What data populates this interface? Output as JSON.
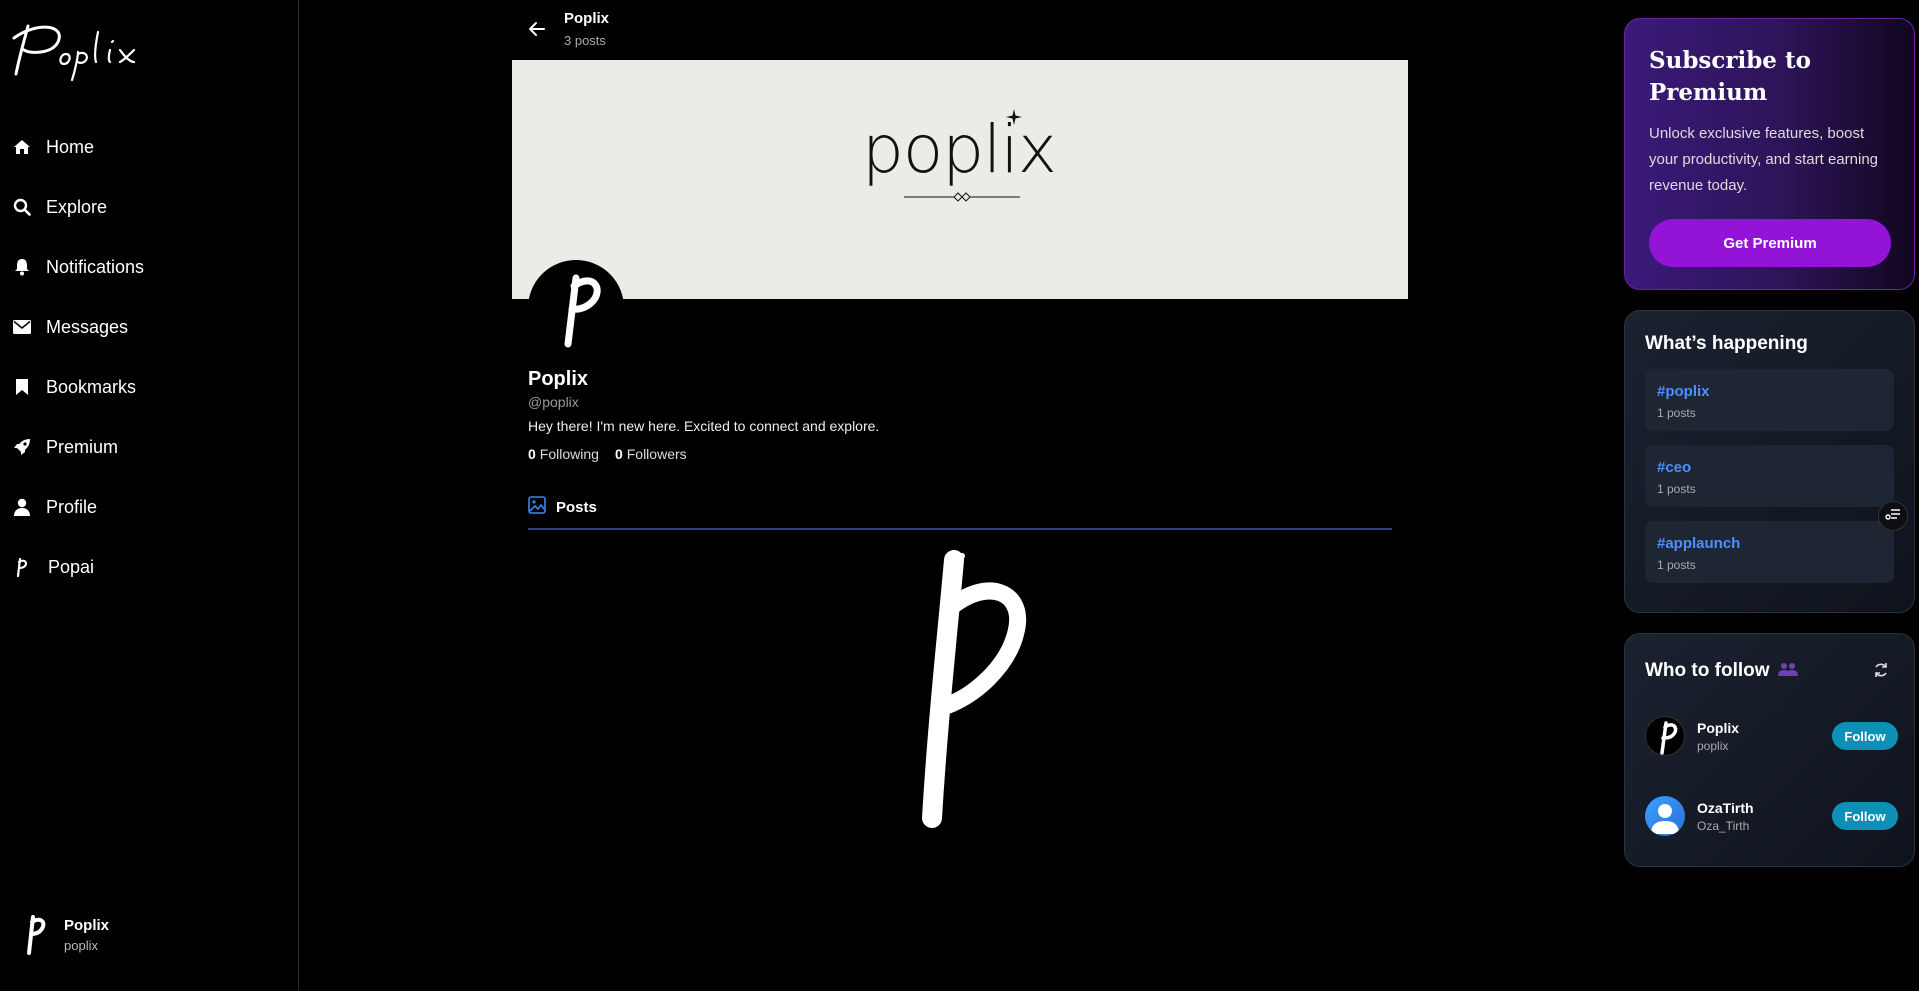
{
  "app": {
    "logo_text": "Poplix"
  },
  "nav": {
    "items": [
      {
        "label": "Home",
        "icon": "home-icon"
      },
      {
        "label": "Explore",
        "icon": "search-icon"
      },
      {
        "label": "Notifications",
        "icon": "bell-icon"
      },
      {
        "label": "Messages",
        "icon": "envelope-icon"
      },
      {
        "label": "Bookmarks",
        "icon": "bookmark-icon"
      },
      {
        "label": "Premium",
        "icon": "rocket-icon"
      },
      {
        "label": "Profile",
        "icon": "user-icon"
      },
      {
        "label": "Popai",
        "icon": "popai-p-icon"
      }
    ]
  },
  "account": {
    "name": "Poplix",
    "handle": "poplix"
  },
  "topbar": {
    "title": "Poplix",
    "post_count": "3 posts"
  },
  "banner": {
    "logo_text": "poplix"
  },
  "profile": {
    "name": "Poplix",
    "handle": "@poplix",
    "bio": "Hey there! I'm new here. Excited to connect and explore.",
    "following_count": "0",
    "following_label": "Following",
    "followers_count": "0",
    "followers_label": "Followers"
  },
  "tabs": {
    "posts_label": "Posts"
  },
  "premium": {
    "title": "Subscribe to Premium",
    "description": "Unlock exclusive features, boost your productivity, and start earning revenue today.",
    "button_label": "Get Premium"
  },
  "happening": {
    "title": "What’s happening",
    "trends": [
      {
        "tag": "#poplix",
        "count": "1 posts"
      },
      {
        "tag": "#ceo",
        "count": "1 posts"
      },
      {
        "tag": "#applaunch",
        "count": "1 posts"
      }
    ]
  },
  "who_to_follow": {
    "title": "Who to follow",
    "users": [
      {
        "name": "Poplix",
        "handle": "poplix",
        "button": "Follow"
      },
      {
        "name": "OzaTirth",
        "handle": "Oza_Tirth",
        "button": "Follow"
      }
    ]
  },
  "colors": {
    "accent_purple": "#9313d6",
    "follow_blue": "#0e8fb5",
    "trend_blue": "#4a90ff",
    "tab_underline": "#2f3f9a"
  }
}
